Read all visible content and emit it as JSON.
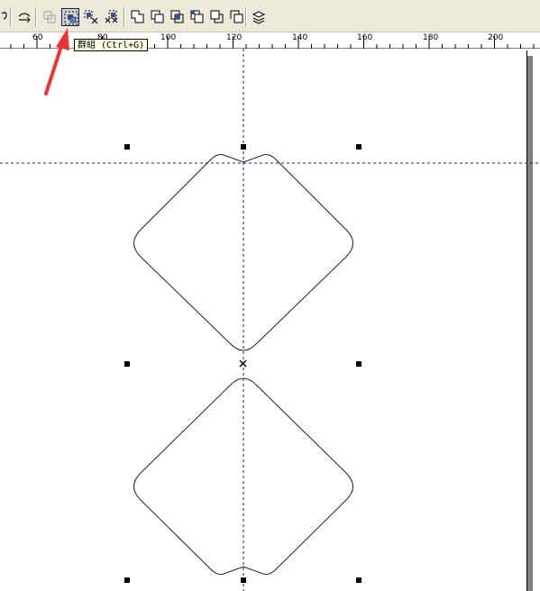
{
  "toolbar": {
    "buttons": [
      {
        "name": "partial-icon",
        "icon": "question-fragment"
      },
      {
        "name": "convert-curve-icon",
        "icon": "convert-to-curves"
      },
      {
        "name": "combine-icon",
        "icon": "combine-disabled"
      },
      {
        "name": "group-icon",
        "icon": "group",
        "active": true
      },
      {
        "name": "ungroup-icon",
        "icon": "ungroup"
      },
      {
        "name": "ungroup-all-icon",
        "icon": "ungroup-all"
      },
      {
        "name": "weld-icon",
        "icon": "weld"
      },
      {
        "name": "trim-icon",
        "icon": "trim"
      },
      {
        "name": "intersect-icon",
        "icon": "intersect"
      },
      {
        "name": "simplify-icon",
        "icon": "simplify"
      },
      {
        "name": "front-minus-back-icon",
        "icon": "front-minus-back"
      },
      {
        "name": "back-minus-front-icon",
        "icon": "back-minus-front"
      },
      {
        "name": "create-boundary-icon",
        "icon": "create-boundary"
      }
    ]
  },
  "tooltip": {
    "text": "群組 (Ctrl+G)"
  },
  "ruler": {
    "labels": [
      "60",
      "80",
      "100",
      "120",
      "140",
      "160",
      "180",
      "200"
    ]
  },
  "colors": {
    "annotation_arrow": "#ee3333",
    "guideline": "#1a1a8c",
    "handle": "#000000"
  }
}
